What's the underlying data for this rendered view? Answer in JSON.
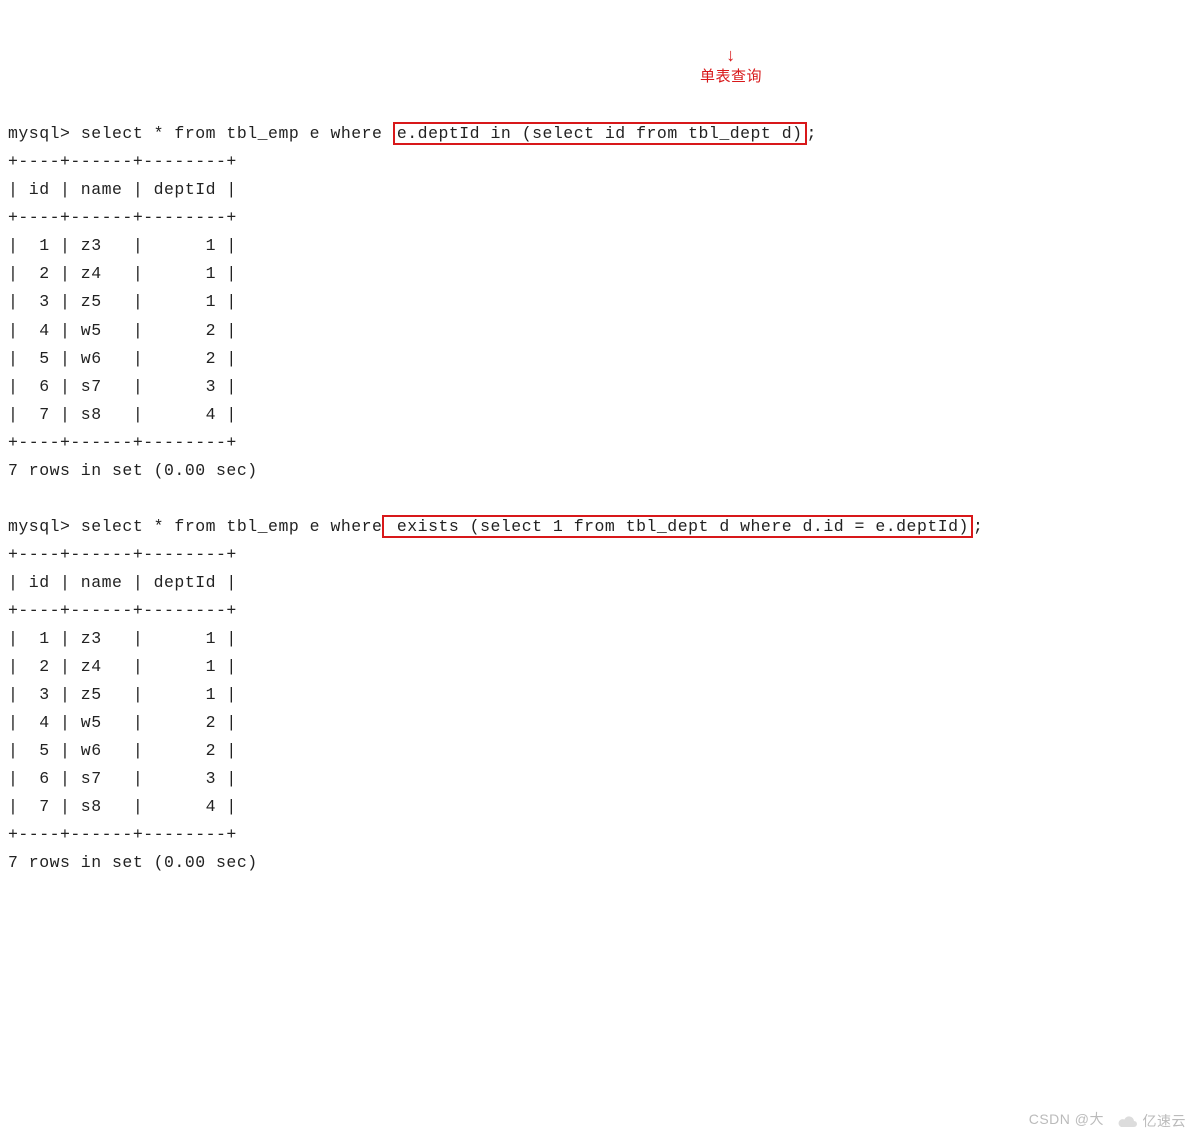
{
  "query1": {
    "prompt": "mysql> ",
    "pre_box": "select * from tbl_emp e where ",
    "boxed": "e.deptId in (select id from tbl_dept d)",
    "post_box": ";"
  },
  "annotation": {
    "arrow": "↓",
    "label": "单表查询"
  },
  "table": {
    "border_top": "+----+------+--------+",
    "header": "| id | name | deptId |",
    "border_mid": "+----+------+--------+",
    "rows": [
      "|  1 | z3   |      1 |",
      "|  2 | z4   |      1 |",
      "|  3 | z5   |      1 |",
      "|  4 | w5   |      2 |",
      "|  5 | w6   |      2 |",
      "|  6 | s7   |      3 |",
      "|  7 | s8   |      4 |"
    ],
    "border_bot": "+----+------+--------+",
    "footer": "7 rows in set (0.00 sec)"
  },
  "query2": {
    "prompt": "mysql> ",
    "pre_box": "select * from tbl_emp e where",
    "boxed": " exists (select 1 from tbl_dept d where d.id = e.deptId)",
    "post_box": ";"
  },
  "watermark": "CSDN @大",
  "logo_text": "亿速云"
}
